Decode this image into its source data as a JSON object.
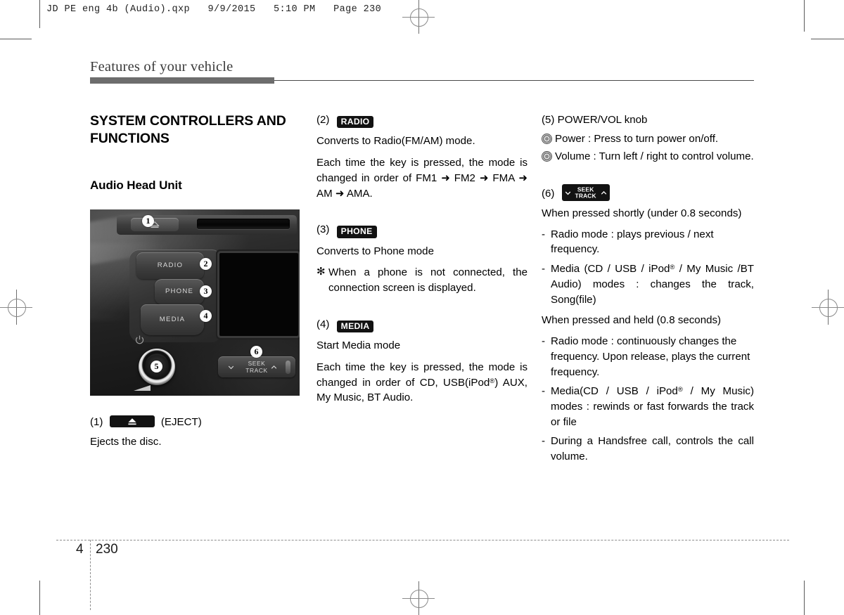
{
  "prepress": {
    "header": "JD PE eng 4b (Audio).qxp   9/9/2015   5:10 PM   Page 230"
  },
  "running_head": "Features of your vehicle",
  "section": {
    "title": "SYSTEM CONTROLLERS AND FUNCTIONS",
    "subtitle": "Audio Head Unit"
  },
  "photo": {
    "labels": {
      "radio": "RADIO",
      "phone": "PHONE",
      "media": "MEDIA",
      "seek": "SEEK",
      "track": "TRACK"
    },
    "callouts": [
      "1",
      "2",
      "3",
      "4",
      "5",
      "6"
    ]
  },
  "items": {
    "item1": {
      "number": "(1)",
      "badge": "eject-badge",
      "suffix": "(EJECT)",
      "body": "Ejects the disc."
    },
    "item2": {
      "number": "(2)",
      "badge": "RADIO",
      "line1": "Converts to Radio(FM/AM) mode.",
      "line2_pre": "Each time the key is pressed, the mode is changed in order of FM1",
      "seq": [
        "FM1",
        "FM2",
        "FMA",
        "AM",
        "AMA"
      ],
      "line2_full": "Each time the key is pressed, the mode is changed in order of FM1 ➜ FM2 ➜ FMA ➜ AM ➜ AMA."
    },
    "item3": {
      "number": "(3)",
      "badge": "PHONE",
      "line1": "Converts to Phone mode",
      "note_symbol": "✻",
      "note": "When a phone is not connected, the connection screen is displayed."
    },
    "item4": {
      "number": "(4)",
      "badge": "MEDIA",
      "line1": "Start Media mode",
      "line2_a": "Each time the key is pressed, the mode is changed in order of CD, USB(iPod",
      "line2_reg": "®",
      "line2_b": ") AUX, My Music, BT Audio."
    },
    "item5": {
      "number": "(5)",
      "title": "POWER/VOL knob",
      "bullets": [
        "Power : Press to turn power on/off.",
        "Volume : Turn left / right to control volume."
      ]
    },
    "item6": {
      "number": "(6)",
      "badge_seek": "SEEK",
      "badge_track": "TRACK",
      "short_press_heading": "When pressed shortly (under 0.8 seconds)",
      "short_press_items": [
        {
          "dash": "-",
          "text": "Radio mode : plays previous / next frequency."
        },
        {
          "dash": "-",
          "text_a": "Media (CD / USB / iPod",
          "reg": "®",
          "text_b": " / My Music /BT Audio) modes : changes the track, Song(file)"
        }
      ],
      "long_press_heading": "When pressed and held (0.8 seconds)",
      "long_press_items": [
        {
          "dash": "-",
          "text": "Radio mode : continuously changes the frequency. Upon release, plays the current frequency."
        },
        {
          "dash": "-",
          "text_a": "Media(CD / USB / iPod",
          "reg": "®",
          "text_b": " / My Music) modes : rewinds or fast forwards the track or file"
        },
        {
          "dash": "-",
          "text": "During a Handsfree call, controls the call volume."
        }
      ]
    }
  },
  "footer": {
    "chapter": "4",
    "page": "230"
  },
  "colors": {
    "badge_bg": "#121212",
    "rule_dark": "#6d6d6d",
    "running_head": "#3b3b3b"
  }
}
